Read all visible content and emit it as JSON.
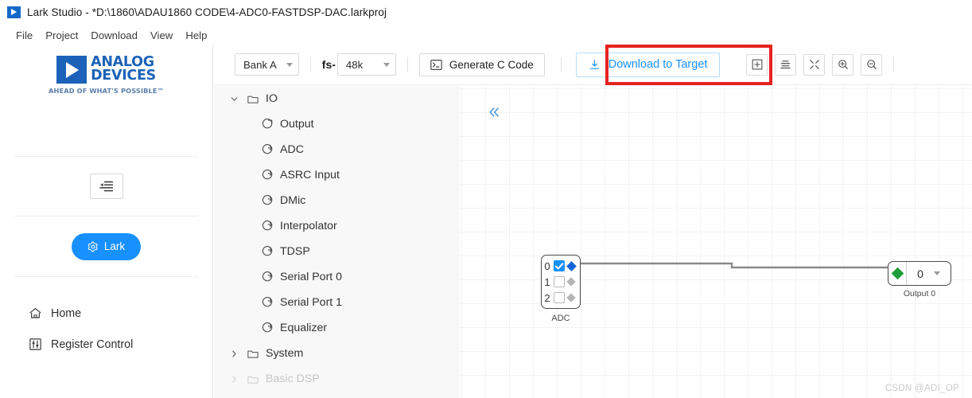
{
  "window": {
    "title": "Lark Studio - *D:\\1860\\ADAU1860 CODE\\4-ADC0-FASTDSP-DAC.larkproj",
    "app_icon": "play-triangle-icon"
  },
  "menubar": {
    "items": [
      {
        "label": "File"
      },
      {
        "label": "Project"
      },
      {
        "label": "Download"
      },
      {
        "label": "View"
      },
      {
        "label": "Help"
      }
    ]
  },
  "sidebar": {
    "logo": {
      "line1": "ANALOG",
      "line2": "DEVICES",
      "tagline": "AHEAD OF WHAT'S POSSIBLE™",
      "brand_color": "#1c62b9"
    },
    "collapse_button_icon": "indent-list-icon",
    "lark_button": {
      "label": "Lark",
      "icon": "gear-icon",
      "color": "#1890ff"
    },
    "nav": [
      {
        "label": "Home",
        "icon": "home-icon"
      },
      {
        "label": "Register Control",
        "icon": "sliders-icon"
      }
    ]
  },
  "toolbar": {
    "bank_select": {
      "value": "Bank A",
      "icon": "chevron-down-icon"
    },
    "fs_label": "fs-",
    "fs_select": {
      "value": "48k",
      "icon": "chevron-down-icon"
    },
    "generate_button": {
      "label": "Generate C Code",
      "icon": "terminal-icon"
    },
    "download_button": {
      "label": "Download to Target",
      "icon": "download-icon",
      "color": "#1890ff"
    },
    "highlight_color": "#e52321",
    "icon_buttons": [
      {
        "name": "add-node-icon",
        "title": "Add"
      },
      {
        "name": "align-icon",
        "title": "Align"
      },
      {
        "name": "fit-to-screen-icon",
        "title": "Fit to screen"
      },
      {
        "name": "zoom-in-icon",
        "title": "Zoom in"
      },
      {
        "name": "zoom-out-icon",
        "title": "Zoom out"
      }
    ]
  },
  "tree": {
    "items": [
      {
        "label": "IO",
        "level": 1,
        "expanded": true,
        "icon": "folder-icon"
      },
      {
        "label": "Output",
        "level": 2,
        "icon": "output-arrow-icon"
      },
      {
        "label": "ADC",
        "level": 2,
        "icon": "input-arrow-icon"
      },
      {
        "label": "ASRC Input",
        "level": 2,
        "icon": "input-arrow-icon"
      },
      {
        "label": "DMic",
        "level": 2,
        "icon": "input-arrow-icon"
      },
      {
        "label": "Interpolator",
        "level": 2,
        "icon": "input-arrow-icon"
      },
      {
        "label": "TDSP",
        "level": 2,
        "icon": "input-arrow-icon"
      },
      {
        "label": "Serial Port 0",
        "level": 2,
        "icon": "input-arrow-icon"
      },
      {
        "label": "Serial Port 1",
        "level": 2,
        "icon": "input-arrow-icon"
      },
      {
        "label": "Equalizer",
        "level": 2,
        "icon": "input-arrow-icon"
      },
      {
        "label": "System",
        "level": 1,
        "expanded": false,
        "icon": "folder-icon"
      },
      {
        "label": "Basic DSP",
        "level": 1,
        "expanded": false,
        "icon": "folder-icon"
      }
    ]
  },
  "canvas": {
    "collapse_icon": "double-chevron-left-icon",
    "adc_node": {
      "caption": "ADC",
      "channels": [
        {
          "index": "0",
          "checked": true,
          "port_active": true
        },
        {
          "index": "1",
          "checked": false,
          "port_active": false
        },
        {
          "index": "2",
          "checked": false,
          "port_active": false
        }
      ]
    },
    "output_node": {
      "caption": "Output 0",
      "value": "0",
      "icon": "chevron-down-icon",
      "port_color": "#1f9d3b"
    }
  },
  "watermark": "CSDN @ADI_OP"
}
